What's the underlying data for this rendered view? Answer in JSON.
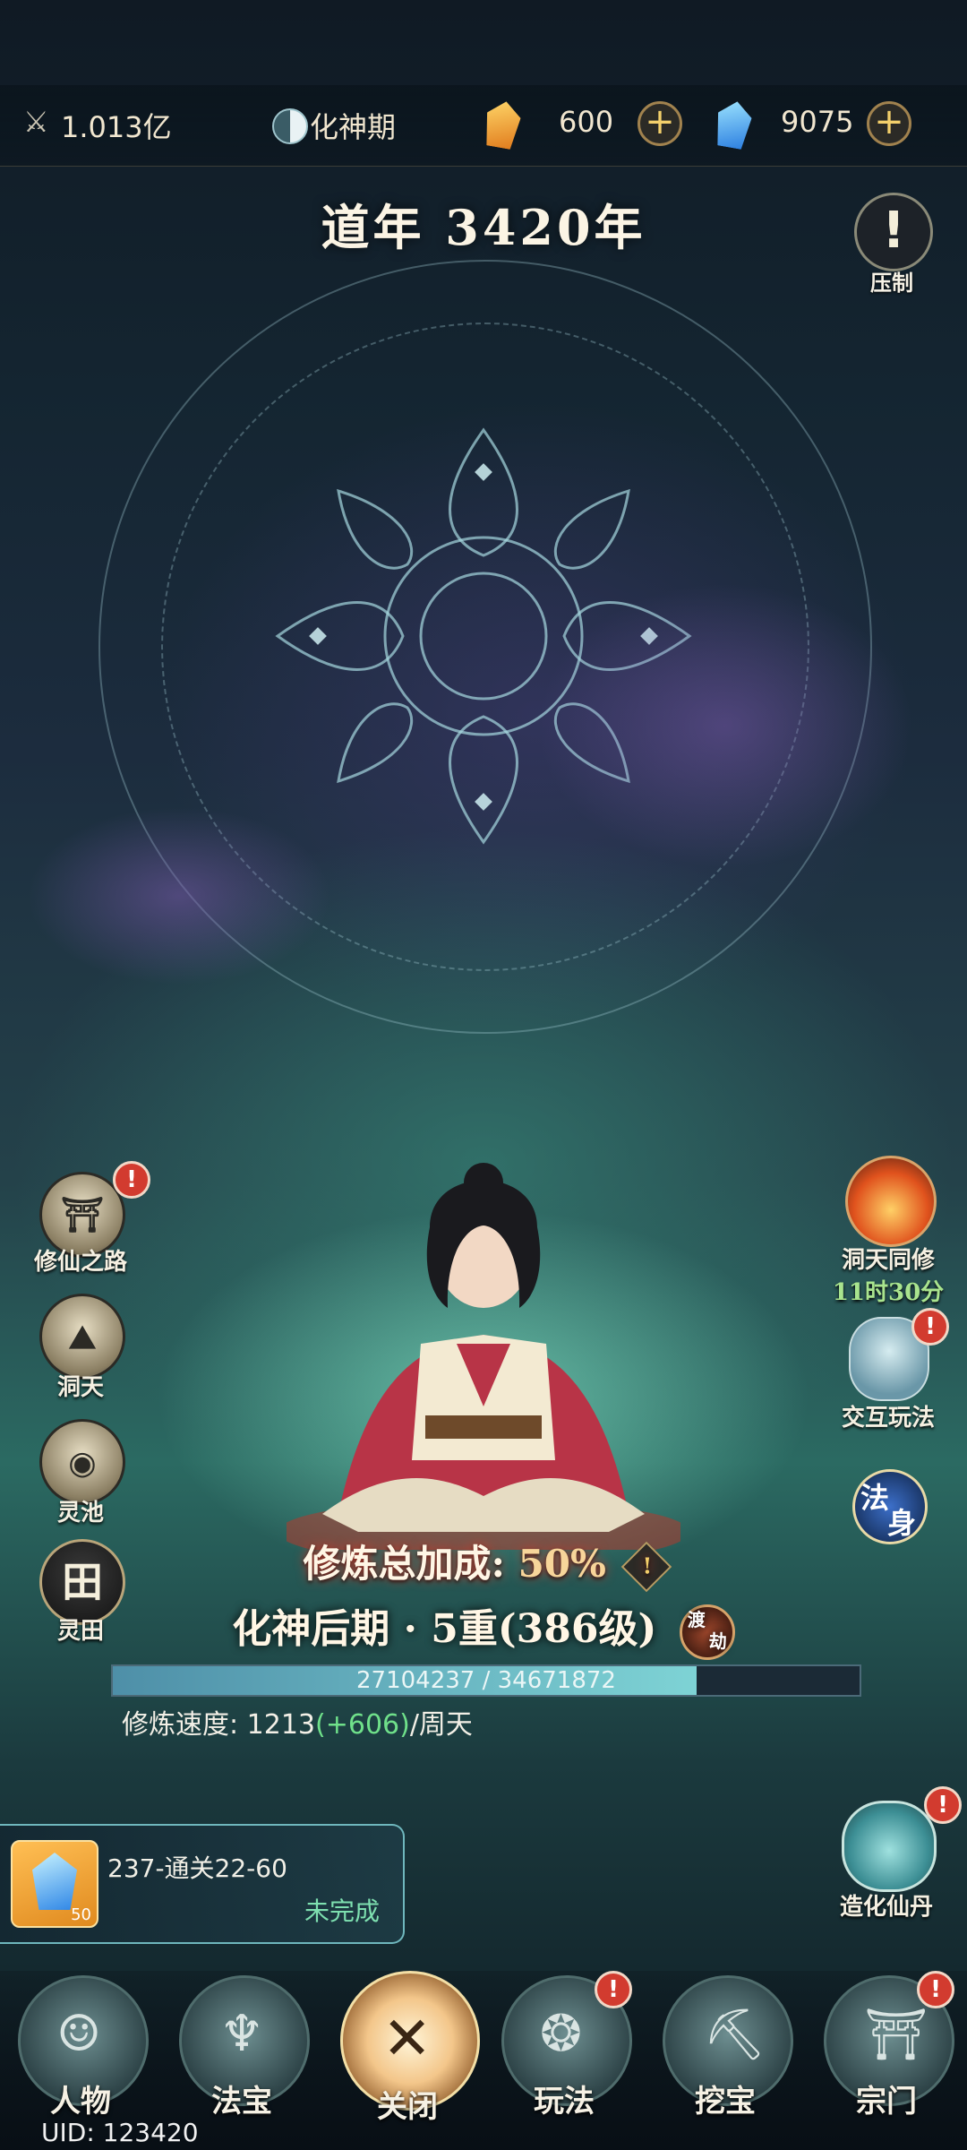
{
  "topbar": {
    "power": "1.013亿",
    "realm_name": "化神期",
    "gold_amount": "600",
    "crystal_amount": "9075"
  },
  "dao_year": "道年 3420年",
  "suppress_label": "压制",
  "left_menu": [
    {
      "label": "修仙之路",
      "badge": "!"
    },
    {
      "label": "洞天",
      "badge": ""
    },
    {
      "label": "灵池",
      "badge": ""
    },
    {
      "label": "灵田",
      "icon_char": "田",
      "badge": ""
    }
  ],
  "right_menu": {
    "dongtian_tongxiu": "洞天同修",
    "dongtian_timer": "11时30分",
    "interact": "交互玩法",
    "fashen_chars": [
      "法",
      "身"
    ],
    "pill": "造化仙丹",
    "badge": "!"
  },
  "cultivation": {
    "bonus_label": "修炼总加成:",
    "bonus_value": "50%",
    "realm_text": "化神后期 · 5重(386级)",
    "dujie": [
      "渡",
      "劫"
    ],
    "exp_text": "27104237 / 34671872",
    "exp_fraction": 0.7817,
    "speed_label": "修炼速度:",
    "speed_value": "1213",
    "speed_bonus": "(+606)",
    "speed_unit": "/周天"
  },
  "quest": {
    "title": "237-通关22-60",
    "status": "未完成",
    "item_count": "50"
  },
  "bottom_nav": [
    {
      "label": "人物",
      "badge": ""
    },
    {
      "label": "法宝",
      "badge": ""
    },
    {
      "label": "关闭",
      "badge": ""
    },
    {
      "label": "玩法",
      "badge": "!"
    },
    {
      "label": "挖宝",
      "badge": ""
    },
    {
      "label": "宗门",
      "badge": "!"
    }
  ],
  "uid": "UID: 123420",
  "colors": {
    "accent_gold": "#f3cf6b",
    "badge_red": "#d23b2f",
    "speed_green": "#6fe08a",
    "exp_fill": "#7ed3d5"
  }
}
